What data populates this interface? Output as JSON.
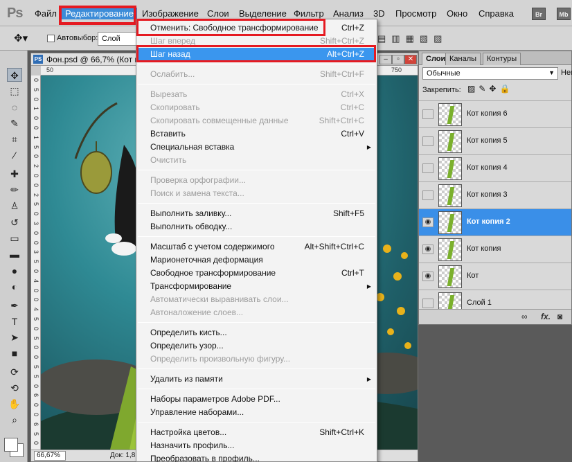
{
  "app": {
    "logo": "Ps"
  },
  "menubar": {
    "items": [
      "Файл",
      "Редактирование",
      "Изображение",
      "Слои",
      "Выделение",
      "Фильтр",
      "Анализ",
      "3D",
      "Просмотр",
      "Окно",
      "Справка"
    ],
    "bridge_btn": "Br",
    "minibridge_btn": "Mb"
  },
  "options": {
    "autoselect_label": "Автовыбор:",
    "autoselect_value": "Слой"
  },
  "document": {
    "title": "Фон.psd @ 66,7% (Кот к",
    "icon": "PS",
    "ruler_top": [
      "50",
      "750"
    ],
    "ruler_left": [
      "0",
      "5",
      "0",
      "1",
      "0",
      "0",
      "1",
      "5",
      "0",
      "2",
      "0",
      "0",
      "2",
      "5",
      "0",
      "3",
      "0",
      "0",
      "3",
      "5",
      "0",
      "4",
      "0",
      "0",
      "4",
      "5",
      "0",
      "5",
      "0",
      "0",
      "5",
      "5",
      "0",
      "6",
      "0",
      "0",
      "6",
      "5",
      "0"
    ],
    "zoom": "66,67%",
    "info": "Док: 1,8"
  },
  "edit_menu": {
    "items": [
      {
        "label": "Отменить: Свободное трансформирование",
        "shortcut": "Ctrl+Z",
        "disabled": false
      },
      {
        "label": "Шаг вперед",
        "shortcut": "Shift+Ctrl+Z",
        "disabled": true
      },
      {
        "label": "Шаг назад",
        "shortcut": "Alt+Ctrl+Z",
        "disabled": false,
        "hover": true
      },
      {
        "sep": true
      },
      {
        "label": "Ослабить...",
        "shortcut": "Shift+Ctrl+F",
        "disabled": true
      },
      {
        "sep": true
      },
      {
        "label": "Вырезать",
        "shortcut": "Ctrl+X",
        "disabled": true
      },
      {
        "label": "Скопировать",
        "shortcut": "Ctrl+C",
        "disabled": true
      },
      {
        "label": "Скопировать совмещенные данные",
        "shortcut": "Shift+Ctrl+C",
        "disabled": true
      },
      {
        "label": "Вставить",
        "shortcut": "Ctrl+V",
        "disabled": false
      },
      {
        "label": "Специальная вставка",
        "shortcut": "",
        "disabled": false,
        "submenu": true
      },
      {
        "label": "Очистить",
        "shortcut": "",
        "disabled": true
      },
      {
        "sep": true
      },
      {
        "label": "Проверка орфографии...",
        "shortcut": "",
        "disabled": true
      },
      {
        "label": "Поиск и замена текста...",
        "shortcut": "",
        "disabled": true
      },
      {
        "sep": true
      },
      {
        "label": "Выполнить заливку...",
        "shortcut": "Shift+F5",
        "disabled": false
      },
      {
        "label": "Выполнить обводку...",
        "shortcut": "",
        "disabled": false
      },
      {
        "sep": true
      },
      {
        "label": "Масштаб с учетом содержимого",
        "shortcut": "Alt+Shift+Ctrl+C",
        "disabled": false
      },
      {
        "label": "Марионеточная деформация",
        "shortcut": "",
        "disabled": false
      },
      {
        "label": "Свободное трансформирование",
        "shortcut": "Ctrl+T",
        "disabled": false
      },
      {
        "label": "Трансформирование",
        "shortcut": "",
        "disabled": false,
        "submenu": true
      },
      {
        "label": "Автоматически выравнивать слои...",
        "shortcut": "",
        "disabled": true
      },
      {
        "label": "Автоналожение слоев...",
        "shortcut": "",
        "disabled": true
      },
      {
        "sep": true
      },
      {
        "label": "Определить кисть...",
        "shortcut": "",
        "disabled": false
      },
      {
        "label": "Определить узор...",
        "shortcut": "",
        "disabled": false
      },
      {
        "label": "Определить произвольную фигуру...",
        "shortcut": "",
        "disabled": true
      },
      {
        "sep": true
      },
      {
        "label": "Удалить из памяти",
        "shortcut": "",
        "disabled": false,
        "submenu": true
      },
      {
        "sep": true
      },
      {
        "label": "Наборы параметров Adobe PDF...",
        "shortcut": "",
        "disabled": false
      },
      {
        "label": "Управление наборами...",
        "shortcut": "",
        "disabled": false
      },
      {
        "sep": true
      },
      {
        "label": "Настройка цветов...",
        "shortcut": "Shift+Ctrl+K",
        "disabled": false
      },
      {
        "label": "Назначить профиль...",
        "shortcut": "",
        "disabled": false
      },
      {
        "label": "Преобразовать в профиль...",
        "shortcut": "",
        "disabled": false
      }
    ]
  },
  "layers_panel": {
    "tabs": [
      "Слои",
      "Каналы",
      "Контуры"
    ],
    "blend_mode": "Обычные",
    "opacity_label": "Неп",
    "lock_label": "Закрепить:",
    "layers": [
      {
        "name": "Кот копия 6",
        "visible": false,
        "selected": false
      },
      {
        "name": "Кот копия 5",
        "visible": false,
        "selected": false
      },
      {
        "name": "Кот копия 4",
        "visible": false,
        "selected": false
      },
      {
        "name": "Кот копия 3",
        "visible": false,
        "selected": false
      },
      {
        "name": "Кот копия 2",
        "visible": true,
        "selected": true
      },
      {
        "name": "Кот копия",
        "visible": true,
        "selected": false
      },
      {
        "name": "Кот",
        "visible": true,
        "selected": false
      },
      {
        "name": "Слой 1",
        "visible": false,
        "selected": false
      }
    ],
    "footer_fx": "fx."
  },
  "colors": {
    "accent": "#3a96ee",
    "highlight_box": "#e51a21",
    "menu_bg": "#f3f3f3"
  }
}
